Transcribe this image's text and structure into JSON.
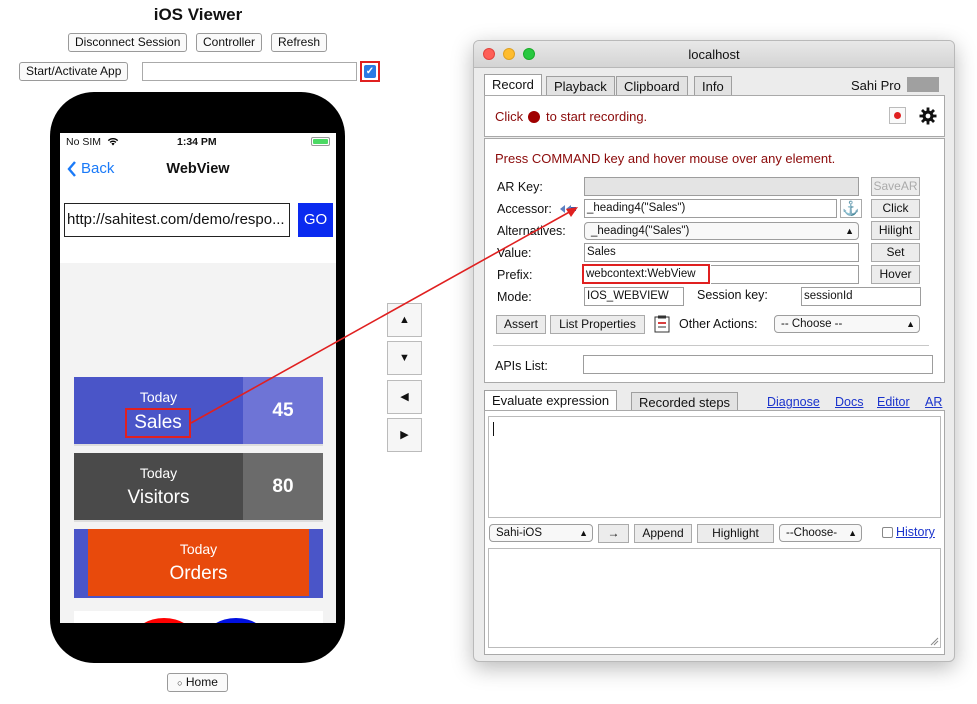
{
  "viewer": {
    "title": "iOS Viewer",
    "disconnect_label": "Disconnect Session",
    "controller_label": "Controller",
    "refresh_label": "Refresh",
    "start_label": "Start/Activate App",
    "checkbox_mark": "✓",
    "home_label": "Home"
  },
  "phone": {
    "carrier": "No SIM",
    "time": "1:34 PM",
    "back_label": "Back",
    "nav_title": "WebView",
    "url": "http://sahitest.com/demo/respo...",
    "go_label": "GO",
    "tiles": [
      {
        "top": "Today",
        "label": "Sales",
        "value": "45"
      },
      {
        "top": "Today",
        "label": "Visitors",
        "value": "80"
      },
      {
        "top": "Today",
        "label": "Orders"
      }
    ]
  },
  "arrows": {
    "up": "▲",
    "down": "▼",
    "left": "◀",
    "right": "▶"
  },
  "window": {
    "title": "localhost",
    "tabs": [
      "Record",
      "Playback",
      "Clipboard",
      "Info"
    ],
    "brand": "Sahi Pro",
    "record_msg_prefix": "Click",
    "record_msg_suffix": "to start recording.",
    "hint": "Press COMMAND key and hover mouse over any element.",
    "labels": {
      "ar_key": "AR Key:",
      "accessor": "Accessor:",
      "alternatives": "Alternatives:",
      "value": "Value:",
      "prefix": "Prefix:",
      "mode": "Mode:",
      "session_key": "Session key:",
      "other_actions": "Other Actions:",
      "apis_list": "APIs List:"
    },
    "values": {
      "accessor": "_heading4(\"Sales\")",
      "alternatives": "_heading4(\"Sales\")",
      "value": "Sales",
      "prefix": "webcontext:WebView",
      "mode": "IOS_WEBVIEW",
      "session_key": "sessionId",
      "other_actions": "-- Choose --"
    },
    "buttons": {
      "save_ar": "SaveAR",
      "anchor": "⚓",
      "click": "Click",
      "hilight": "Hilight",
      "set": "Set",
      "hover": "Hover",
      "assert": "Assert",
      "list_properties": "List Properties"
    },
    "lower_tabs": [
      "Evaluate expression",
      "Recorded steps"
    ],
    "links": [
      "Diagnose",
      "Docs",
      "Editor",
      "AR"
    ],
    "controls": {
      "engine": "Sahi-iOS",
      "arrow": "→",
      "append": "Append",
      "highlight": "Highlight",
      "choose": "--Choose-",
      "history": "History"
    }
  },
  "colors": {
    "sales_left": "#4a55c8",
    "sales_right": "#6e74d6",
    "visitors_left": "#4a4a4a",
    "visitors_right": "#6b6b6b",
    "orders": "#e84a0c",
    "orders_edge": "#4a55c8",
    "highlight_red": "#e02020",
    "link_blue": "#1a33cc",
    "record_dot": "#a00000"
  }
}
